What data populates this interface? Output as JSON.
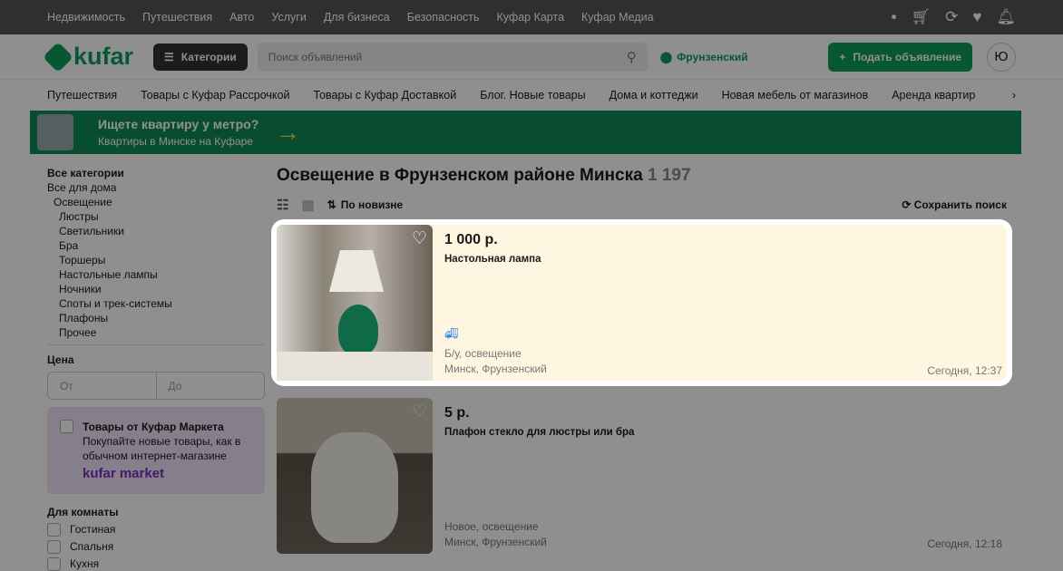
{
  "topbar": {
    "links": [
      "Недвижимость",
      "Путешествия",
      "Авто",
      "Услуги",
      "Для бизнеса",
      "Безопасность",
      "Куфар Карта",
      "Куфар Медиа"
    ]
  },
  "header": {
    "logo": "kufar",
    "categories": "Категории",
    "search_placeholder": "Поиск объявлений",
    "location": "Фрунзенский",
    "post": "Подать объявление",
    "avatar": "Ю"
  },
  "nav": [
    "Путешествия",
    "Товары с Куфар Рассрочкой",
    "Товары с Куфар Доставкой",
    "Блог. Новые товары",
    "Дома и коттеджи",
    "Новая мебель от магазинов",
    "Аренда квартир"
  ],
  "banner": {
    "title": "Ищете квартиру у метро?",
    "subtitle": "Квартиры в Минске на Куфаре"
  },
  "sidebar": {
    "all": "Все категории",
    "home": "Все для дома",
    "current": "Освещение",
    "subs": [
      "Люстры",
      "Светильники",
      "Бра",
      "Торшеры",
      "Настольные лампы",
      "Ночники",
      "Споты и трек-системы",
      "Плафоны",
      "Прочее"
    ],
    "price_label": "Цена",
    "from": "От",
    "to": "До",
    "market_title": "Товары от Куфар Маркета",
    "market_text": "Покупайте новые товары, как в обычном интернет-магазине",
    "market_logo": "kufar market",
    "room_label": "Для комнаты",
    "rooms": [
      "Гостиная",
      "Спальня",
      "Кухня"
    ]
  },
  "main": {
    "title": "Освещение в Фрунзенском районе Минска",
    "count": "1 197",
    "sort": "По новизне",
    "save_search": "Сохранить поиск",
    "listings": [
      {
        "price": "1 000 р.",
        "name": "Настольная лампа",
        "condition": "Б/у, освещение",
        "location": "Минск, Фрунзенский",
        "date": "Сегодня, 12:37"
      },
      {
        "price": "5 р.",
        "name": "Плафон стекло для люстры или бра",
        "condition": "Новое, освещение",
        "location": "Минск, Фрунзенский",
        "date": "Сегодня, 12:18"
      }
    ]
  }
}
